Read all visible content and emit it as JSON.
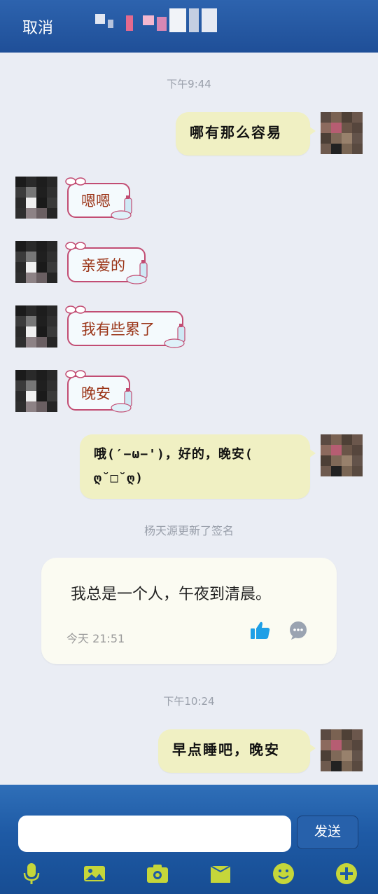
{
  "header": {
    "cancel_label": "取消"
  },
  "messages": {
    "time_1": "下午9:44",
    "out_1": "哪有那么容易",
    "in_1": "嗯嗯",
    "in_2": "亲爱的",
    "in_3": "我有些累了",
    "in_4": "晚安",
    "out_2_line1": "哦(′−ω−')，好的，晚安(",
    "out_2_line2": "ღ˘□˘ღ)",
    "system_update": "杨天源更新了签名",
    "time_2": "下午10:24",
    "out_3": "早点睡吧，晚安"
  },
  "signature_card": {
    "text": "我总是一个人，午夜到清晨。",
    "date": "今天 21:51",
    "like_icon": "thumbs-up-icon",
    "comment_icon": "comment-icon"
  },
  "input_bar": {
    "placeholder": "",
    "send_label": "发送"
  },
  "toolbar": {
    "icons": [
      "microphone-icon",
      "picture-icon",
      "camera-icon",
      "folder-icon",
      "emoji-icon",
      "plus-icon"
    ]
  },
  "colors": {
    "header_blue": "#1f4f98",
    "outgoing_bubble": "#f0f0c3",
    "incoming_border": "#c24d73",
    "incoming_text": "#9a3316",
    "toolbar_icon": "#c5d63a",
    "like_blue": "#1e9fe6"
  }
}
